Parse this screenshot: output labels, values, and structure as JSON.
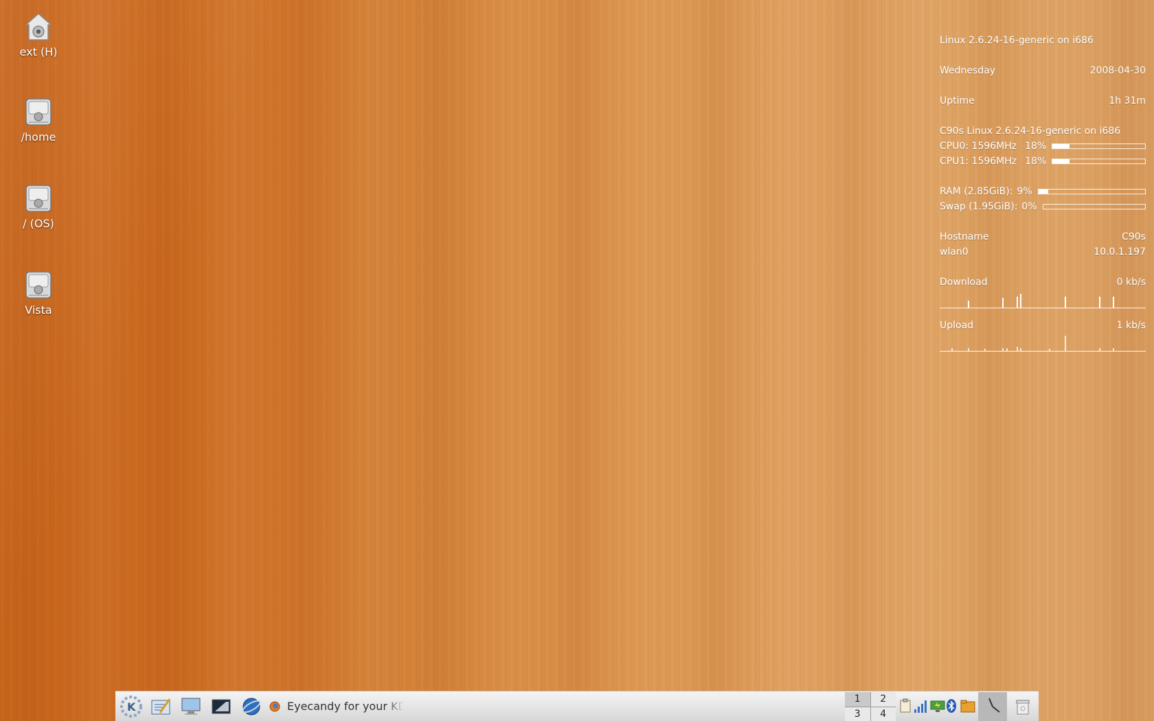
{
  "desktop_icons": [
    {
      "label": "ext (H)",
      "icon": "home-drive-icon"
    },
    {
      "label": "/home",
      "icon": "hard-drive-icon"
    },
    {
      "label": "/ (OS)",
      "icon": "hard-drive-icon"
    },
    {
      "label": "Vista",
      "icon": "hard-drive-icon"
    }
  ],
  "conky": {
    "kernel": "Linux 2.6.24-16-generic on i686",
    "day": "Wednesday",
    "date": "2008-04-30",
    "uptime_label": "Uptime",
    "uptime_value": "1h 31m",
    "system": "C90s Linux 2.6.24-16-generic on i686",
    "cpu0_label": "CPU0: 1596MHz",
    "cpu0_pct": "18%",
    "cpu0_level": 0.18,
    "cpu1_label": "CPU1: 1596MHz",
    "cpu1_pct": "18%",
    "cpu1_level": 0.18,
    "ram_label": "RAM (2.85GiB):",
    "ram_pct": "9%",
    "ram_level": 0.09,
    "swap_label": "Swap (1.95GiB):",
    "swap_pct": "0%",
    "swap_level": 0.0,
    "hostname_label": "Hostname",
    "hostname_value": "C90s",
    "iface_label": "wlan0",
    "iface_value": "10.0.1.197",
    "download_label": "Download",
    "download_value": "0 kb/s",
    "upload_label": "Upload",
    "upload_value": "1 kb/s"
  },
  "taskbar": {
    "task_title": "Eyecandy for your KDE",
    "pager": [
      "1",
      "2",
      "3",
      "4"
    ],
    "launchers": [
      "kde-menu-icon",
      "text-editor-icon",
      "desktop-icon",
      "terminal-icon",
      "web-browser-icon",
      "firefox-icon"
    ],
    "tray": [
      "clipboard-icon",
      "wifi-signal-icon",
      "network-icon",
      "bluetooth-icon",
      "folder-icon",
      "clock-icon",
      "trash-icon"
    ]
  },
  "colors": {
    "panel_text": "#ffffff",
    "taskbar_bg": "#e4e4e4"
  }
}
